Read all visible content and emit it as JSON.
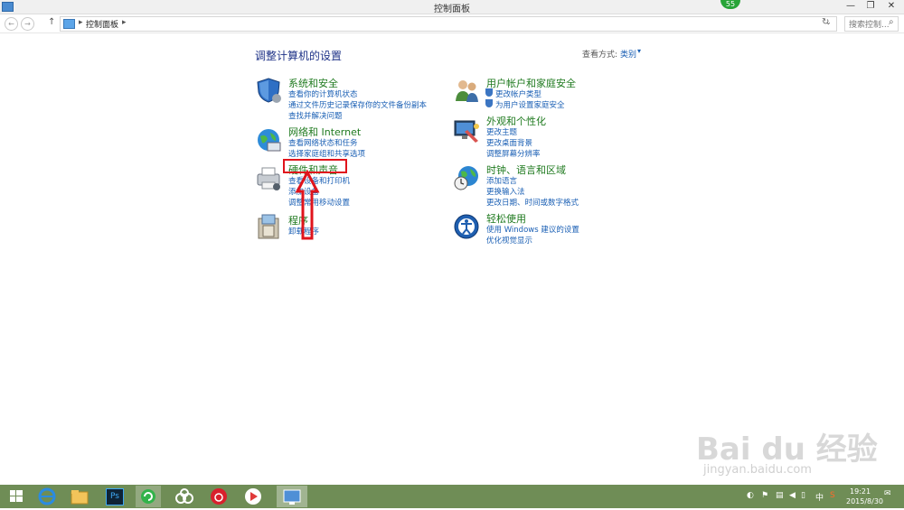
{
  "window": {
    "title": "控制面板",
    "minimize": "—",
    "restore": "❐",
    "close": "✕",
    "badge": "55"
  },
  "address": {
    "back": "←",
    "forward": "→",
    "up": "↑",
    "crumbs": [
      "▸",
      "控制面板",
      "▸"
    ],
    "dropdown": "⌄",
    "refresh": "↻",
    "search_placeholder": "搜索控制...",
    "search_icon": "⌕"
  },
  "main": {
    "heading": "调整计算机的设置",
    "view_by_label": "查看方式:",
    "view_by_value": "类别",
    "view_by_arrow": "▾",
    "categories": [
      {
        "title": "系统和安全",
        "icon": "shield-icon",
        "links": [
          "查看你的计算机状态",
          "通过文件历史记录保存你的文件备份副本",
          "查找并解决问题"
        ]
      },
      {
        "title": "网络和 Internet",
        "icon": "network-globe-icon",
        "links": [
          "查看网络状态和任务",
          "选择家庭组和共享选项"
        ]
      },
      {
        "title": "硬件和声音",
        "icon": "printer-icon",
        "links": [
          "查看设备和打印机",
          "添加设备",
          "调整常用移动设置"
        ]
      },
      {
        "title": "程序",
        "icon": "programs-icon",
        "links": [
          "卸载程序"
        ]
      },
      {
        "title": "用户帐户和家庭安全",
        "icon": "users-icon",
        "links": [
          "更改帐户类型",
          "为用户设置家庭安全"
        ]
      },
      {
        "title": "外观和个性化",
        "icon": "display-icon",
        "links": [
          "更改主题",
          "更改桌面背景",
          "调整屏幕分辨率"
        ]
      },
      {
        "title": "时钟、语言和区域",
        "icon": "clock-globe-icon",
        "links": [
          "添加语言",
          "更换输入法",
          "更改日期、时间或数字格式"
        ]
      },
      {
        "title": "轻松使用",
        "icon": "accessibility-icon",
        "links": [
          "使用 Windows 建议的设置",
          "优化视觉显示"
        ]
      }
    ]
  },
  "taskbar": {
    "time": "19:21",
    "date": "2015/8/30",
    "ime": "中",
    "apps": [
      "start-icon",
      "ie-icon",
      "explorer-icon",
      "photoshop-icon",
      "refresh-app-icon",
      "cloud-app-icon",
      "netease-music-icon",
      "media-player-icon",
      "control-panel-icon"
    ],
    "ps_label": "Ps"
  },
  "watermark": {
    "logo": "Bai du 经验",
    "url": "jingyan.baidu.com"
  },
  "colors": {
    "category_title": "#1f7a1f",
    "link": "#1a5fb4",
    "heading": "#1e3287",
    "highlight": "#e0141c",
    "taskbar": "#6f8d56"
  }
}
